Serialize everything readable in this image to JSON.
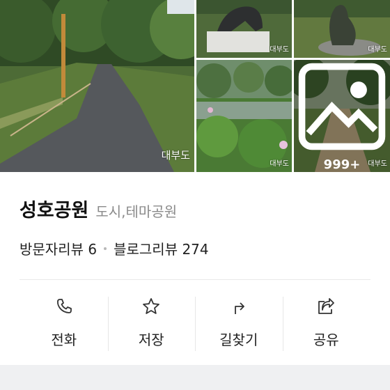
{
  "gallery": {
    "watermark": "대부도",
    "more_count": "999+",
    "more_icon": "image-icon"
  },
  "place": {
    "name": "성호공원",
    "category": "도시,테마공원"
  },
  "reviews": {
    "visitor": "방문자리뷰 6",
    "blog": "블로그리뷰 274"
  },
  "actions": [
    {
      "label": "전화",
      "icon": "phone-icon"
    },
    {
      "label": "저장",
      "icon": "star-icon"
    },
    {
      "label": "길찾기",
      "icon": "directions-icon"
    },
    {
      "label": "공유",
      "icon": "share-icon"
    }
  ],
  "colors": {
    "category_text": "#8a8a8a",
    "divider": "#e8e8e8",
    "bottom_band": "#eff0f2"
  }
}
